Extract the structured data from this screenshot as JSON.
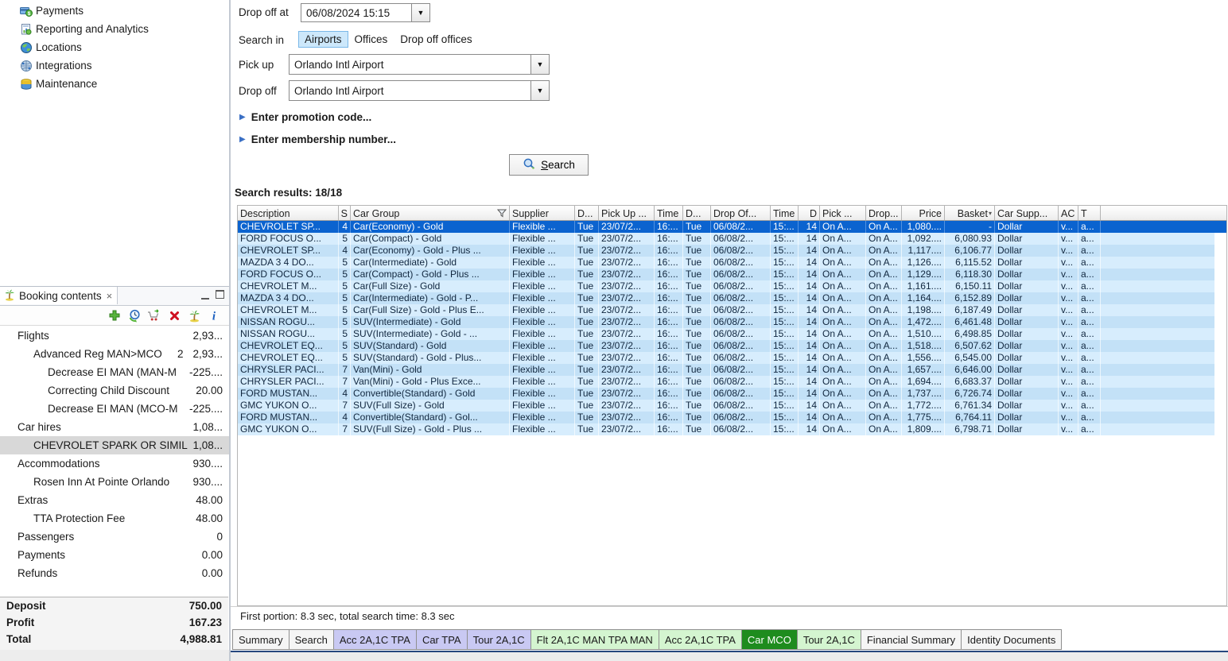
{
  "colors": {
    "selection_blue": "#0b63cf",
    "row_stripe_dark": "#c3e1f7",
    "row_stripe_light": "#d7edfd",
    "tab_lavender": "#c9c9f3",
    "tab_green": "#d4f5d0",
    "tab_active_green": "#1e8c1e",
    "chip_highlight": "#cde8fb"
  },
  "nav_menu": {
    "items": [
      {
        "label": "Payments",
        "icon": "payments-icon"
      },
      {
        "label": "Reporting and Analytics",
        "icon": "reporting-icon"
      },
      {
        "label": "Locations",
        "icon": "locations-icon"
      },
      {
        "label": "Integrations",
        "icon": "integrations-icon"
      },
      {
        "label": "Maintenance",
        "icon": "maintenance-icon"
      }
    ]
  },
  "search_form": {
    "drop_off_at": {
      "label": "Drop off at",
      "value": "06/08/2024 15:15"
    },
    "search_in": {
      "label": "Search in",
      "options": [
        "Airports",
        "Offices",
        "Drop off offices"
      ],
      "selected": "Airports"
    },
    "pick_up": {
      "label": "Pick up",
      "value": "Orlando Intl Airport"
    },
    "drop_off": {
      "label": "Drop off",
      "value": "Orlando Intl Airport"
    },
    "promo_toggle": "Enter promotion code...",
    "membership_toggle": "Enter membership number...",
    "search_button": "Search"
  },
  "results": {
    "title": "Search results: 18/18",
    "columns": [
      "Description",
      "S",
      "Car Group",
      "Supplier",
      "D...",
      "Pick Up ...",
      "Time",
      "D...",
      "Drop Of...",
      "Time",
      "D",
      "Pick ...",
      "Drop...",
      "Price",
      "Basket",
      "Car Supp...",
      "AC",
      "T"
    ],
    "selected_index": 0,
    "common": {
      "supplier": "Flexible ...",
      "day_pu": "Tue",
      "pickup_date": "23/07/2...",
      "pickup_time": "16:...",
      "day_do": "Tue",
      "dropoff_date": "06/08/2...",
      "dropoff_time": "15:...",
      "days": "14",
      "pick_loc": "On A...",
      "drop_loc": "On A...",
      "car_supplier": "Dollar",
      "ac": "v...",
      "t": "a..."
    },
    "rows": [
      {
        "description": "CHEVROLET SP...",
        "seats": "4",
        "car_group": "Car(Economy) - Gold",
        "price": "1,080....",
        "basket": "-"
      },
      {
        "description": "FORD FOCUS O...",
        "seats": "5",
        "car_group": "Car(Compact) - Gold",
        "price": "1,092....",
        "basket": "6,080.93"
      },
      {
        "description": "CHEVROLET SP...",
        "seats": "4",
        "car_group": "Car(Economy) - Gold - Plus ...",
        "price": "1,117....",
        "basket": "6,106.77"
      },
      {
        "description": "MAZDA 3 4 DO...",
        "seats": "5",
        "car_group": "Car(Intermediate) - Gold",
        "price": "1,126....",
        "basket": "6,115.52"
      },
      {
        "description": "FORD FOCUS O...",
        "seats": "5",
        "car_group": "Car(Compact) - Gold - Plus ...",
        "price": "1,129....",
        "basket": "6,118.30"
      },
      {
        "description": "CHEVROLET M...",
        "seats": "5",
        "car_group": "Car(Full Size) - Gold",
        "price": "1,161....",
        "basket": "6,150.11"
      },
      {
        "description": "MAZDA 3 4 DO...",
        "seats": "5",
        "car_group": "Car(Intermediate) - Gold - P...",
        "price": "1,164....",
        "basket": "6,152.89"
      },
      {
        "description": "CHEVROLET M...",
        "seats": "5",
        "car_group": "Car(Full Size) - Gold - Plus E...",
        "price": "1,198....",
        "basket": "6,187.49"
      },
      {
        "description": "NISSAN ROGU...",
        "seats": "5",
        "car_group": "SUV(Intermediate) - Gold",
        "price": "1,472....",
        "basket": "6,461.48"
      },
      {
        "description": "NISSAN ROGU...",
        "seats": "5",
        "car_group": "SUV(Intermediate) - Gold - ...",
        "price": "1,510....",
        "basket": "6,498.85"
      },
      {
        "description": "CHEVROLET EQ...",
        "seats": "5",
        "car_group": "SUV(Standard) - Gold",
        "price": "1,518....",
        "basket": "6,507.62"
      },
      {
        "description": "CHEVROLET EQ...",
        "seats": "5",
        "car_group": "SUV(Standard) - Gold - Plus...",
        "price": "1,556....",
        "basket": "6,545.00"
      },
      {
        "description": "CHRYSLER PACI...",
        "seats": "7",
        "car_group": "Van(Mini) - Gold",
        "price": "1,657....",
        "basket": "6,646.00"
      },
      {
        "description": "CHRYSLER PACI...",
        "seats": "7",
        "car_group": "Van(Mini) - Gold - Plus Exce...",
        "price": "1,694....",
        "basket": "6,683.37"
      },
      {
        "description": "FORD MUSTAN...",
        "seats": "4",
        "car_group": "Convertible(Standard) - Gold",
        "price": "1,737....",
        "basket": "6,726.74"
      },
      {
        "description": "GMC YUKON O...",
        "seats": "7",
        "car_group": "SUV(Full Size) - Gold",
        "price": "1,772....",
        "basket": "6,761.34"
      },
      {
        "description": "FORD MUSTAN...",
        "seats": "4",
        "car_group": "Convertible(Standard) - Gol...",
        "price": "1,775....",
        "basket": "6,764.11"
      },
      {
        "description": "GMC YUKON O...",
        "seats": "7",
        "car_group": "SUV(Full Size) - Gold - Plus ...",
        "price": "1,809....",
        "basket": "6,798.71"
      }
    ]
  },
  "status_bar": {
    "text": "First portion: 8.3 sec, total search time: 8.3 sec"
  },
  "bottom_tabs": [
    {
      "label": "Summary",
      "type": "plain"
    },
    {
      "label": "Search",
      "type": "plain"
    },
    {
      "label": "Acc 2A,1C TPA",
      "type": "lavender"
    },
    {
      "label": "Car TPA",
      "type": "lavender"
    },
    {
      "label": "Tour 2A,1C",
      "type": "lavender"
    },
    {
      "label": "Flt 2A,1C MAN TPA MAN",
      "type": "green"
    },
    {
      "label": "Acc 2A,1C TPA",
      "type": "green"
    },
    {
      "label": "Car MCO",
      "type": "active"
    },
    {
      "label": "Tour 2A,1C",
      "type": "green"
    },
    {
      "label": "Financial Summary",
      "type": "plain"
    },
    {
      "label": "Identity Documents",
      "type": "plain"
    }
  ],
  "booking_panel": {
    "title": "Booking contents",
    "tree": [
      {
        "label": "Flights",
        "value": "2,93...",
        "level": 1
      },
      {
        "label": "Advanced Reg MAN>MCO",
        "count": "2",
        "value": "2,93...",
        "level": 2
      },
      {
        "label": "Decrease EI MAN (MAN-M",
        "value": "-225....",
        "level": 3
      },
      {
        "label": "Correcting Child Discount",
        "value": "20.00",
        "level": 3
      },
      {
        "label": "Decrease EI MAN (MCO-M",
        "value": "-225....",
        "level": 3
      },
      {
        "label": "Car hires",
        "value": "1,08...",
        "level": 1
      },
      {
        "label": "CHEVROLET SPARK OR SIMIL",
        "value": "1,08...",
        "level": 2,
        "selected": true
      },
      {
        "label": "Accommodations",
        "value": "930....",
        "level": 1
      },
      {
        "label": "Rosen Inn At Pointe Orlando",
        "value": "930....",
        "level": 2
      },
      {
        "label": "Extras",
        "value": "48.00",
        "level": 1
      },
      {
        "label": "TTA Protection Fee",
        "value": "48.00",
        "level": 2
      },
      {
        "label": "Passengers",
        "value": "0",
        "level": 1
      },
      {
        "label": "Payments",
        "value": "0.00",
        "level": 1
      },
      {
        "label": "Refunds",
        "value": "0.00",
        "level": 1
      }
    ],
    "totals": [
      {
        "label": "Deposit",
        "value": "750.00"
      },
      {
        "label": "Profit",
        "value": "167.23"
      },
      {
        "label": "Total",
        "value": "4,988.81"
      }
    ]
  }
}
